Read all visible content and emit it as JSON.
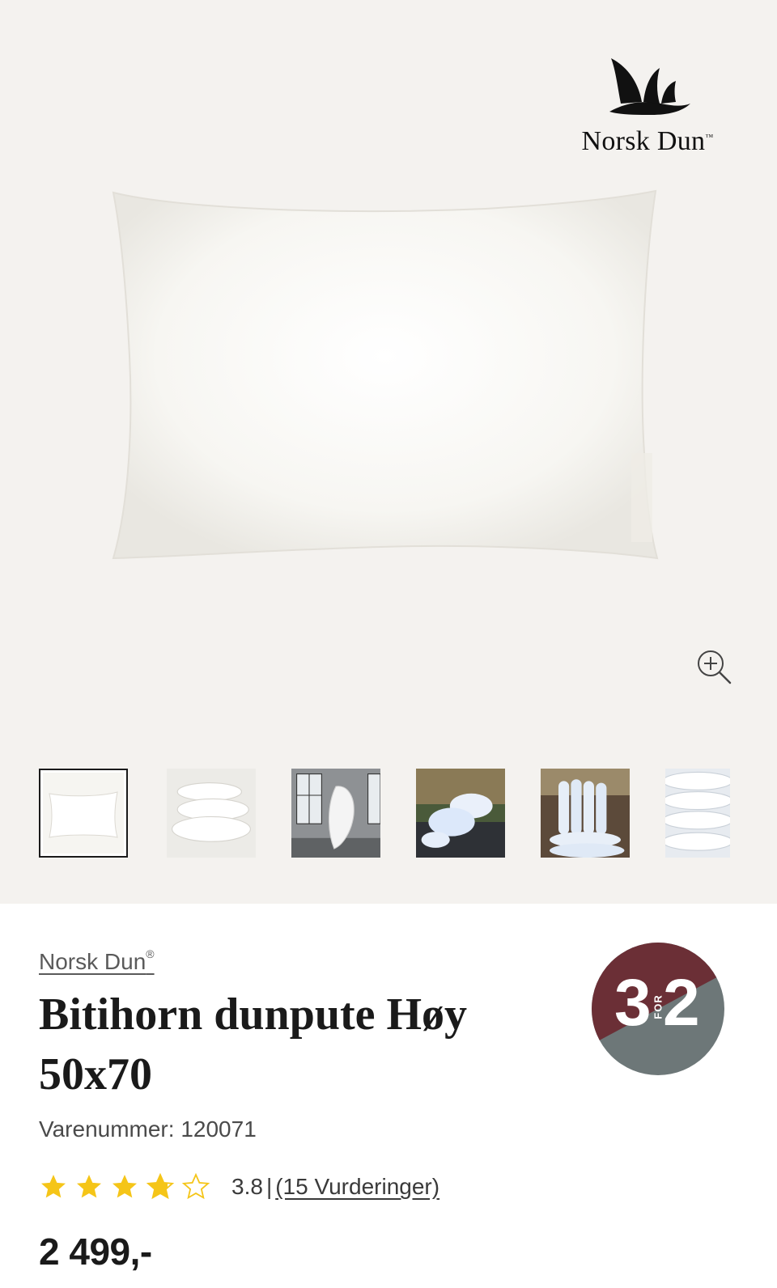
{
  "gallery": {
    "brand_logo_text": "Norsk Dun",
    "brand_logo_tm": "™",
    "thumbnails": [
      {
        "name": "pillow-front",
        "active": true
      },
      {
        "name": "pillow-stack",
        "active": false
      },
      {
        "name": "duvet-room",
        "active": false
      },
      {
        "name": "pillows-outdoor",
        "active": false
      },
      {
        "name": "pillows-pile",
        "active": false
      },
      {
        "name": "pillows-closeup",
        "active": false
      }
    ]
  },
  "product": {
    "brand": "Norsk Dun",
    "brand_mark": "®",
    "title": "Bitihorn dunpute Høy 50x70",
    "sku_label": "Varenummer: ",
    "sku_value": "120071",
    "rating_value": "3.8",
    "rating_fraction": 0.76,
    "rating_separator": "|",
    "rating_count": "(15 Vurderinger)",
    "price": "2 499,-"
  },
  "promo": {
    "left": "3",
    "middle": "FOR",
    "right": "2",
    "colors": {
      "top": "#6b2f36",
      "bottom": "#6d7778"
    }
  },
  "colors": {
    "background_gallery": "#f4f2ef",
    "star": "#f5c518"
  }
}
